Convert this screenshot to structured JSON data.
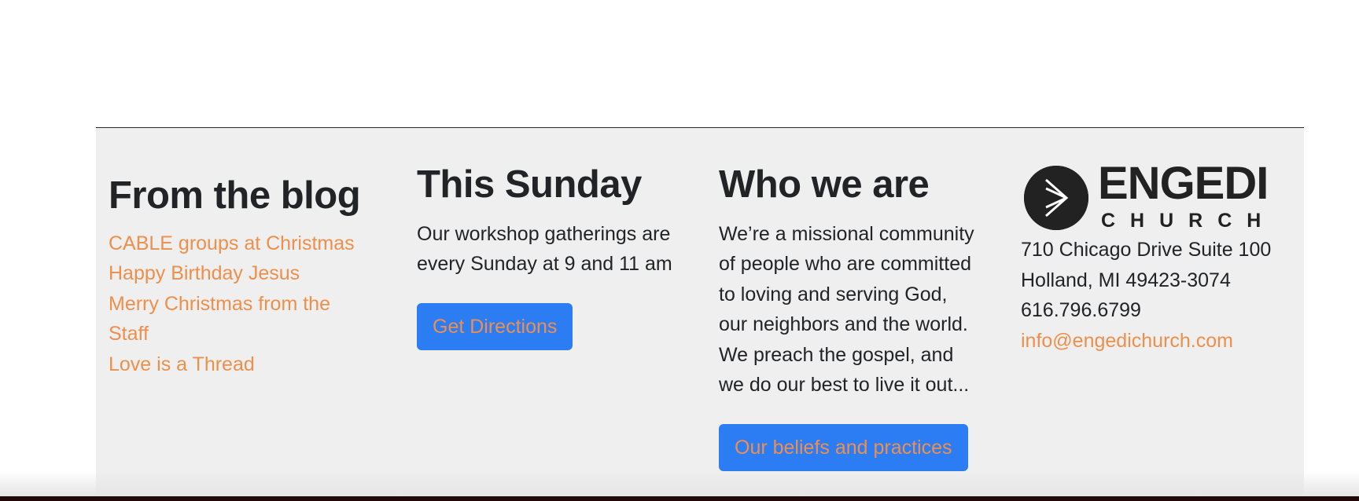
{
  "blog": {
    "heading": "From the blog",
    "posts": [
      "CABLE groups at Christmas",
      "Happy Birthday Jesus",
      "Merry Christmas from the Staff",
      "Love is a Thread"
    ]
  },
  "sunday": {
    "heading": "This Sunday",
    "text": "Our workshop gatherings are every Sunday at 9 and 11 am",
    "button": "Get Directions"
  },
  "who": {
    "heading": "Who we are",
    "text": "We’re a missional community of people who are committed to loving and serving God, our neighbors and the world. We preach the gospel, and we do our best to live it out...",
    "button": "Our beliefs and practices"
  },
  "contact": {
    "logo_word": "ENGEDI",
    "logo_sub": "CHURCH",
    "address1": "710 Chicago Drive Suite 100",
    "address2": "Holland, MI 49423-3074",
    "phone": "616.796.6799",
    "email": "info@engedichurch.com"
  },
  "colors": {
    "link": "#ee8f4c",
    "button_bg": "#2c7df4",
    "panel_bg": "#efefef",
    "text": "#222326"
  }
}
